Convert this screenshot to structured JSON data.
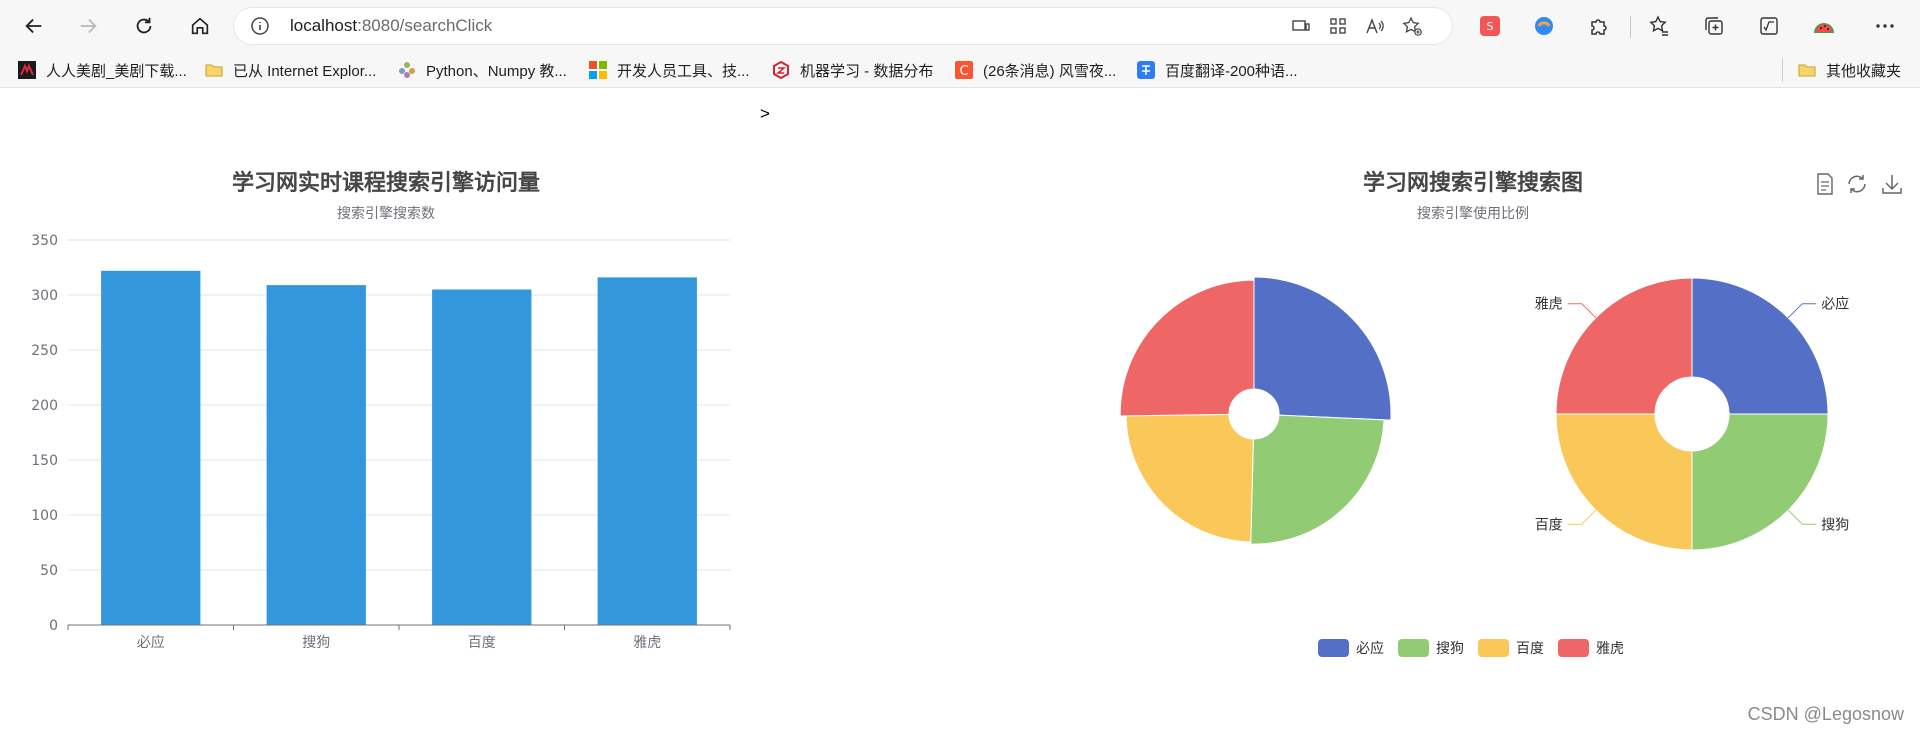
{
  "browser": {
    "url_host": "localhost",
    "url_rest": ":8080/searchClick",
    "bookmarks": [
      {
        "label": "人人美剧_美剧下载...",
        "color": "#c8102e"
      },
      {
        "label": "已从 Internet Explor...",
        "color": "#f2c94c"
      },
      {
        "label": "Python、Numpy 教...",
        "color": "#8a9a5b"
      },
      {
        "label": "开发人员工具、技...",
        "color": "#f25022"
      },
      {
        "label": "机器学习 - 数据分布",
        "color": "#d0272c"
      },
      {
        "label": "(26条消息) 风雪夜...",
        "color": "#fc5531"
      },
      {
        "label": "百度翻译-200种语...",
        "color": "#2f7cf6"
      }
    ],
    "other_bookmarks": "其他收藏夹"
  },
  "page": {
    "stray_text": ">",
    "watermark": "CSDN @Legosnow"
  },
  "chart_data": [
    {
      "type": "bar",
      "title": "学习网实时课程搜索引擎访问量",
      "subtitle": "搜索引擎搜索数",
      "categories": [
        "必应",
        "搜狗",
        "百度",
        "雅虎"
      ],
      "values": [
        322,
        309,
        305,
        316
      ],
      "ylim": [
        0,
        350
      ],
      "yticks": [
        0,
        50,
        100,
        150,
        200,
        250,
        300,
        350
      ],
      "grid": true,
      "color": "#3398db"
    },
    {
      "type": "pie",
      "title": "学习网搜索引擎搜索图",
      "subtitle": "搜索引擎使用比例",
      "legend": [
        "必应",
        "搜狗",
        "百度",
        "雅虎"
      ],
      "legend_position": "bottom",
      "colors": [
        "#5470c6",
        "#91cc75",
        "#fac858",
        "#ee6666"
      ],
      "pies": [
        {
          "variant": "rose-radius",
          "values": [
            322,
            309,
            305,
            316
          ]
        },
        {
          "variant": "donut",
          "labels": [
            "必应",
            "搜狗",
            "百度",
            "雅虎"
          ],
          "values": [
            1,
            1,
            1,
            1
          ]
        }
      ],
      "toolbox": [
        "data-view-icon",
        "restore-icon",
        "save-image-icon"
      ]
    }
  ]
}
